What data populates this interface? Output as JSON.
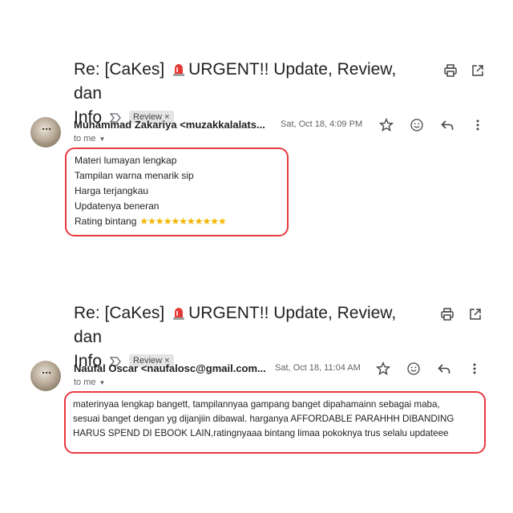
{
  "emails": [
    {
      "subject_prefix": "Re: [CaKes]",
      "subject_rest": "URGENT!! Update, Review, dan",
      "subject_line2": "Info",
      "label": "Review",
      "sender": "Muhammad Zakariya <muzakkalalats...",
      "date": "Sat, Oct 18, 4:09 PM",
      "to": "to me",
      "body_lines": [
        "Materi lumayan lengkap",
        "Tampilan warna menarik sip",
        "Harga terjangkau",
        "Updatenya beneran",
        "Rating bintang"
      ],
      "star_count": 11
    },
    {
      "subject_prefix": "Re: [CaKes]",
      "subject_rest": "URGENT!! Update, Review, dan",
      "subject_line2": "Info",
      "label": "Review",
      "sender": "Naufal Oscar <naufalosc@gmail.com...",
      "date": "Sat, Oct 18, 11:04 AM",
      "to": "to me",
      "body_lines": [
        "materinyaa lengkap bangett, tampilannyaa gampang banget dipahamainn sebagai maba,",
        "sesuai banget dengan yg dijanjiin dibawal. harganya AFFORDABLE PARAHHH DIBANDING",
        "HARUS SPEND DI EBOOK LAIN,ratingnyaaa bintang limaa pokoknya trus selalu updateee"
      ]
    }
  ],
  "colors": {
    "highlight_border": "#e8393f",
    "star": "#f5b400",
    "siren": "#e53935"
  },
  "icons": [
    "siren-icon",
    "important-marker-icon",
    "print-icon",
    "open-new-window-icon",
    "star-icon",
    "emoji-icon",
    "reply-icon",
    "more-vert-icon"
  ]
}
